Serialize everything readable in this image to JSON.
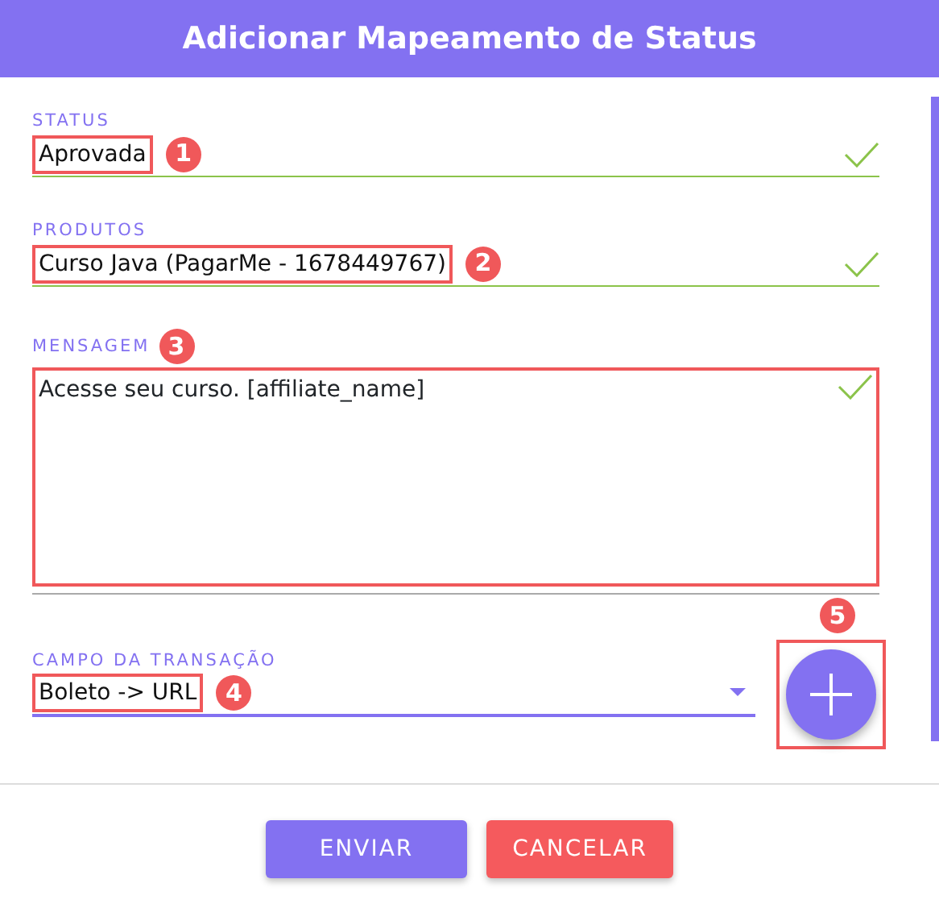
{
  "title": "Adicionar Mapeamento de Status",
  "fields": [
    {
      "kind": "text",
      "label": "STATUS",
      "value": "Aprovada",
      "valid": true,
      "focused": false,
      "marker": "1",
      "marker_on_label": false
    },
    {
      "kind": "text",
      "label": "PRODUTOS",
      "value": "Curso Java (PagarMe - 1678449767)",
      "valid": true,
      "focused": false,
      "marker": "2",
      "marker_on_label": false
    },
    {
      "kind": "textarea",
      "label": "MENSAGEM",
      "value": "Acesse seu curso. [affiliate_name]",
      "valid": true,
      "focused": false,
      "marker": "3",
      "marker_on_label": true
    },
    {
      "kind": "select",
      "label": "CAMPO DA TRANSAÇÃO",
      "value": "Boleto -> URL",
      "valid": false,
      "focused": true,
      "marker": "4",
      "marker_on_label": false
    }
  ],
  "add_button": {
    "marker": "5"
  },
  "buttons": [
    {
      "label": "ENVIAR",
      "kind": "primary"
    },
    {
      "label": "CANCELAR",
      "kind": "danger"
    }
  ]
}
